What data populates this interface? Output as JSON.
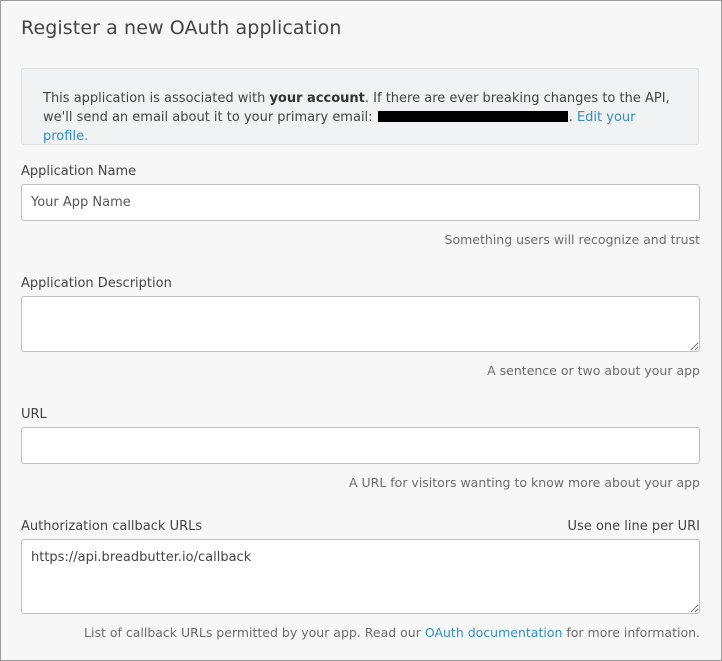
{
  "page": {
    "title": "Register a new OAuth application"
  },
  "notice": {
    "text_before": "This application is associated with ",
    "bold": "your account",
    "text_after": ". If there are ever breaking changes to the API, we'll send an email about it to your primary email:",
    "separator": ".",
    "edit_link": "Edit your profile."
  },
  "form": {
    "app_name": {
      "label": "Application Name",
      "placeholder": "Your App Name",
      "value": "",
      "hint": "Something users will recognize and trust"
    },
    "app_description": {
      "label": "Application Description",
      "value": "",
      "hint": "A sentence or two about your app"
    },
    "url": {
      "label": "URL",
      "value": "",
      "hint": "A URL for visitors wanting to know more about your app"
    },
    "callback": {
      "label": "Authorization callback URLs",
      "side_note": "Use one line per URI",
      "value": "https://api.breadbutter.io/callback",
      "hint_before": "List of callback URLs permitted by your app. Read our ",
      "hint_link": "OAuth documentation",
      "hint_after": " for more information."
    }
  }
}
